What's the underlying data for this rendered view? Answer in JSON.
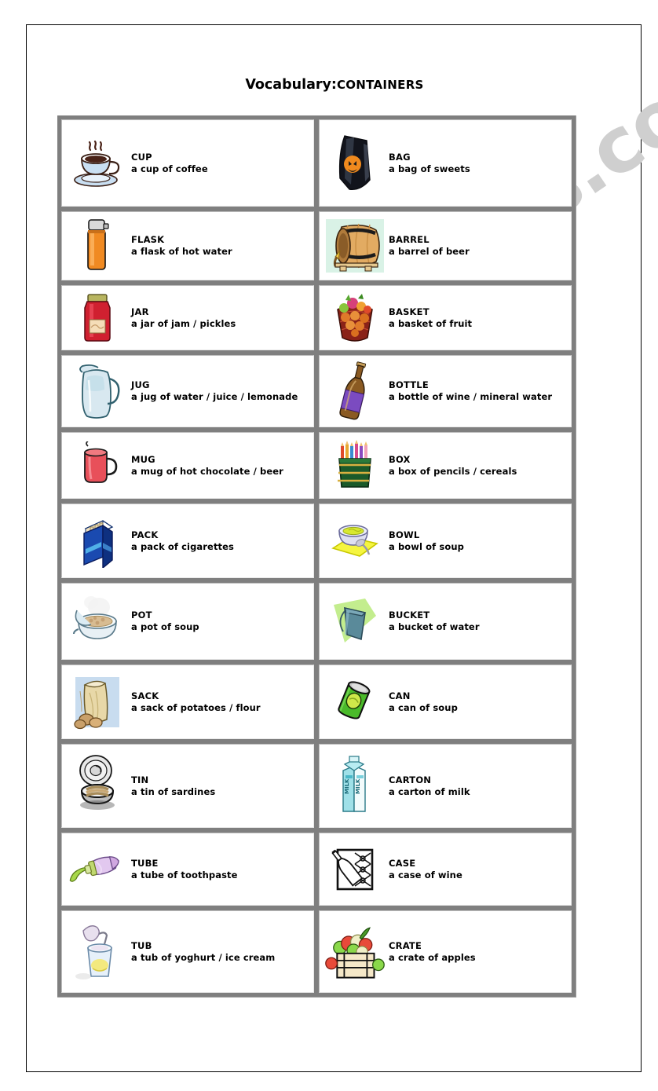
{
  "title": {
    "main": "Vocabulary:",
    "sub": "CONTAINERS"
  },
  "watermark": {
    "text": "ESLprintables.com"
  },
  "table": {
    "rows": [
      {
        "left": {
          "icon": "coffee-cup-icon",
          "term": "CUP",
          "phrase": "a cup of coffee"
        },
        "right": {
          "icon": "sweets-bag-icon",
          "term": "BAG",
          "phrase": "a bag of sweets"
        }
      },
      {
        "left": {
          "icon": "thermos-flask-icon",
          "term": "FLASK",
          "phrase": "a flask of hot water"
        },
        "right": {
          "icon": "beer-barrel-icon",
          "term": "BARREL",
          "phrase": "a barrel of beer"
        }
      },
      {
        "left": {
          "icon": "jam-jar-icon",
          "term": "JAR",
          "phrase": "a jar of jam / pickles"
        },
        "right": {
          "icon": "fruit-basket-icon",
          "term": "BASKET",
          "phrase": "a basket of fruit"
        }
      },
      {
        "left": {
          "icon": "water-jug-icon",
          "term": "JUG",
          "phrase": "a jug of water / juice / lemonade"
        },
        "right": {
          "icon": "wine-bottle-icon",
          "term": "BOTTLE",
          "phrase": "a bottle of wine / mineral water"
        }
      },
      {
        "left": {
          "icon": "red-mug-icon",
          "term": "MUG",
          "phrase": "a mug of hot chocolate / beer"
        },
        "right": {
          "icon": "pencil-box-icon",
          "term": "BOX",
          "phrase": "a box of pencils / cereals"
        }
      },
      {
        "left": {
          "icon": "cigarette-pack-icon",
          "term": "PACK",
          "phrase": "a pack of cigarettes"
        },
        "right": {
          "icon": "soup-bowl-icon",
          "term": "BOWL",
          "phrase": "a bowl of soup"
        }
      },
      {
        "left": {
          "icon": "cooking-pot-icon",
          "term": "POT",
          "phrase": "a pot of soup"
        },
        "right": {
          "icon": "water-bucket-icon",
          "term": "BUCKET",
          "phrase": "a bucket of water"
        }
      },
      {
        "left": {
          "icon": "flour-sack-icon",
          "term": "SACK",
          "phrase": "a sack of potatoes / flour"
        },
        "right": {
          "icon": "soup-can-icon",
          "term": "CAN",
          "phrase": "a can of soup"
        }
      },
      {
        "left": {
          "icon": "sardine-tin-icon",
          "term": "TIN",
          "phrase": "a tin of sardines"
        },
        "right": {
          "icon": "milk-carton-icon",
          "term": "CARTON",
          "phrase": "a carton of milk"
        }
      },
      {
        "left": {
          "icon": "toothpaste-tube-icon",
          "term": "TUBE",
          "phrase": "a tube of toothpaste"
        },
        "right": {
          "icon": "wine-case-icon",
          "term": "CASE",
          "phrase": "a case of wine"
        }
      },
      {
        "left": {
          "icon": "yoghurt-tub-icon",
          "term": "TUB",
          "phrase": "a tub of yoghurt / ice cream"
        },
        "right": {
          "icon": "apple-crate-icon",
          "term": "CRATE",
          "phrase": "a crate of apples"
        }
      }
    ]
  },
  "colors": {
    "table_border": "#7f7f7f",
    "cell_background": "#ffffff",
    "watermark": "#cfcfcf",
    "page_border": "#000000"
  }
}
